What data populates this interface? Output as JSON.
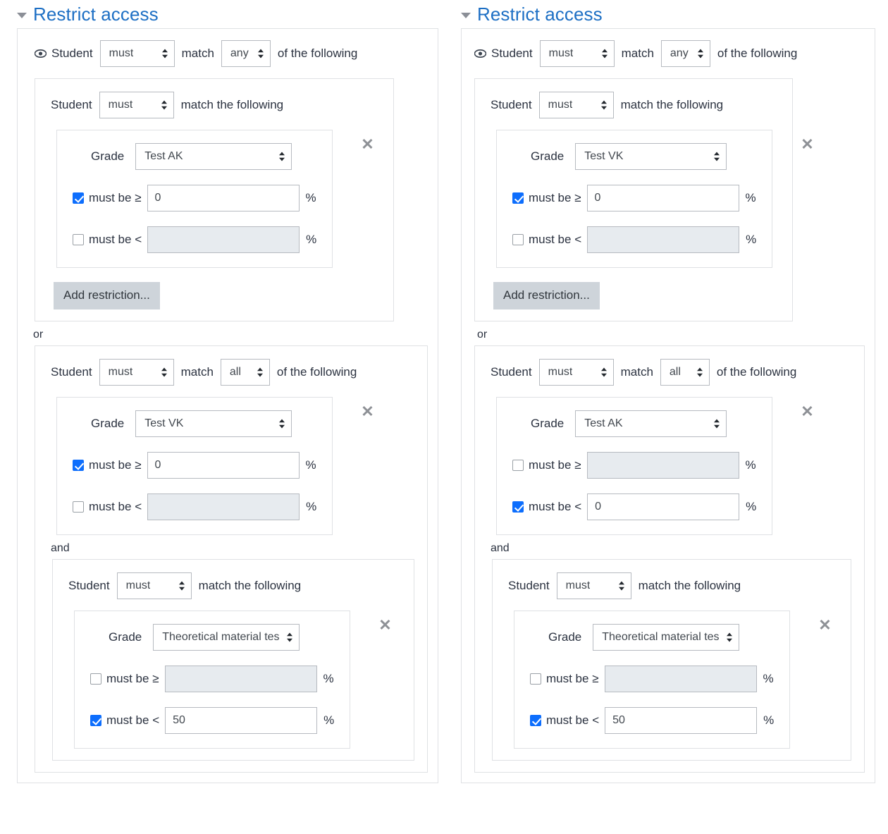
{
  "panels": [
    {
      "heading": "Restrict access",
      "caret_icon": "chevron-down-icon",
      "eye_icon": "eye-icon",
      "top": {
        "student_label": "Student",
        "operator": "must",
        "match_label": "match",
        "quantifier": "any",
        "suffix": "of the following"
      },
      "groups": [
        {
          "student_label": "Student",
          "operator": "must",
          "suffix": "match the following",
          "condition": {
            "grade_label": "Grade",
            "grade_value": "Test AK",
            "min": {
              "label": "must be ≥",
              "checked": true,
              "value": "0",
              "unit": "%"
            },
            "max": {
              "label": "must be <",
              "checked": false,
              "value": "",
              "unit": "%"
            },
            "delete_icon": "close-icon"
          },
          "add_button": "Add restriction..."
        },
        {
          "joiner": "or",
          "student_label": "Student",
          "operator": "must",
          "match_label": "match",
          "quantifier": "all",
          "suffix": "of the following",
          "condition": {
            "grade_label": "Grade",
            "grade_value": "Test VK",
            "min": {
              "label": "must be ≥",
              "checked": true,
              "value": "0",
              "unit": "%"
            },
            "max": {
              "label": "must be <",
              "checked": false,
              "value": "",
              "unit": "%"
            },
            "delete_icon": "close-icon"
          },
          "nested": {
            "joiner": "and",
            "student_label": "Student",
            "operator": "must",
            "suffix": "match the following",
            "condition": {
              "grade_label": "Grade",
              "grade_value": "Theoretical material tes",
              "min": {
                "label": "must be ≥",
                "checked": false,
                "value": "",
                "unit": "%"
              },
              "max": {
                "label": "must be <",
                "checked": true,
                "value": "50",
                "unit": "%"
              },
              "delete_icon": "close-icon"
            }
          }
        }
      ]
    },
    {
      "heading": "Restrict access",
      "caret_icon": "chevron-down-icon",
      "eye_icon": "eye-icon",
      "top": {
        "student_label": "Student",
        "operator": "must",
        "match_label": "match",
        "quantifier": "any",
        "suffix": "of the following"
      },
      "groups": [
        {
          "student_label": "Student",
          "operator": "must",
          "suffix": "match the following",
          "condition": {
            "grade_label": "Grade",
            "grade_value": "Test VK",
            "min": {
              "label": "must be ≥",
              "checked": true,
              "value": "0",
              "unit": "%"
            },
            "max": {
              "label": "must be <",
              "checked": false,
              "value": "",
              "unit": "%"
            },
            "delete_icon": "close-icon"
          },
          "add_button": "Add restriction..."
        },
        {
          "joiner": "or",
          "student_label": "Student",
          "operator": "must",
          "match_label": "match",
          "quantifier": "all",
          "suffix": "of the following",
          "condition": {
            "grade_label": "Grade",
            "grade_value": "Test AK",
            "min": {
              "label": "must be ≥",
              "checked": false,
              "value": "",
              "unit": "%"
            },
            "max": {
              "label": "must be <",
              "checked": true,
              "value": "0",
              "unit": "%"
            },
            "delete_icon": "close-icon"
          },
          "nested": {
            "joiner": "and",
            "student_label": "Student",
            "operator": "must",
            "suffix": "match the following",
            "condition": {
              "grade_label": "Grade",
              "grade_value": "Theoretical material tes",
              "min": {
                "label": "must be ≥",
                "checked": false,
                "value": "",
                "unit": "%"
              },
              "max": {
                "label": "must be <",
                "checked": true,
                "value": "50",
                "unit": "%"
              },
              "delete_icon": "close-icon"
            }
          }
        }
      ]
    }
  ],
  "colors": {
    "heading": "#1d6fc4",
    "checkbox_checked": "#0d6efd",
    "button_bg": "#ced4da",
    "disabled_input": "#e7ebef",
    "border": "#dfe1e4"
  }
}
